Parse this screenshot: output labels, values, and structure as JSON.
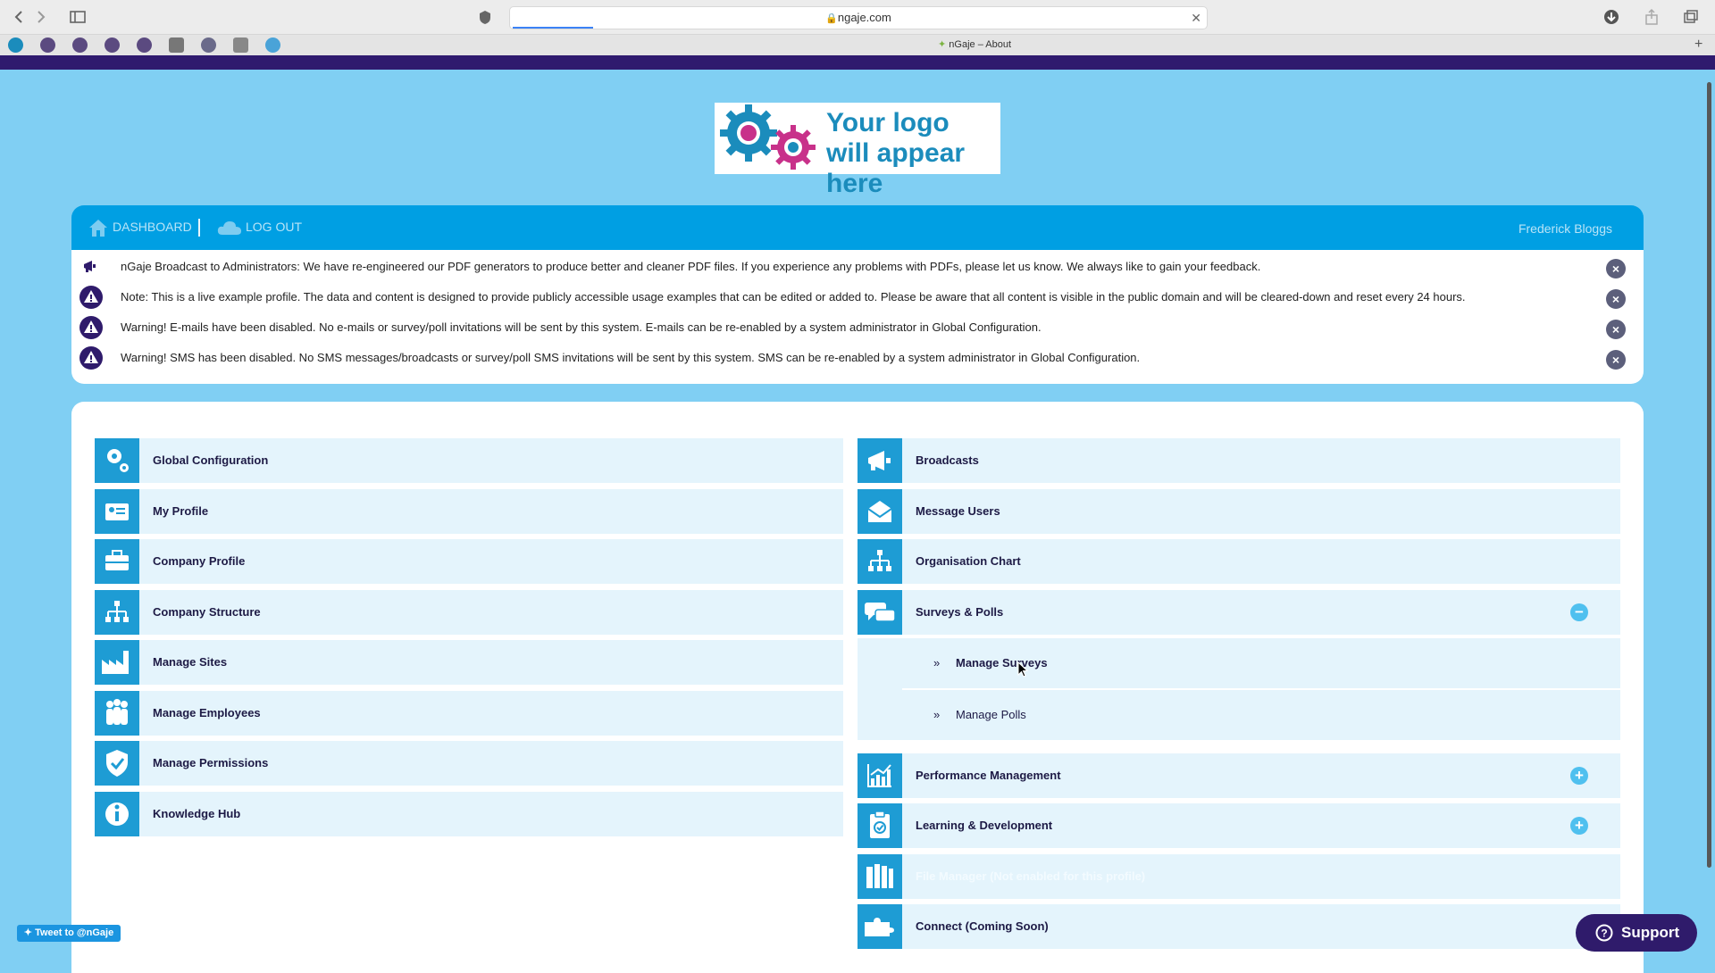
{
  "browser": {
    "url": "ngaje.com",
    "tab_title": "nGaje – About",
    "back_icon": "chevron-left-icon",
    "forward_icon": "chevron-right-icon"
  },
  "logo": {
    "text": "Your logo will appear here",
    "gear_colors": [
      "#1b8cbc",
      "#c8318a"
    ]
  },
  "nav": {
    "dashboard_label": "DASHBOARD",
    "logout_label": "LOG OUT",
    "user_name": "Frederick Bloggs"
  },
  "notices": [
    {
      "icon": "megaphone-icon",
      "text": "nGaje Broadcast to Administrators: We have re-engineered our PDF generators to produce better and cleaner PDF files. If you experience any problems with PDFs, please let us know. We always like to gain your feedback."
    },
    {
      "icon": "warning-icon",
      "text": "Note: This is a live example profile. The data and content is designed to provide publicly accessible usage examples that can be edited or added to. Please be aware that all content is visible in the public domain and will be cleared-down and reset every 24 hours."
    },
    {
      "icon": "warning-icon",
      "text": "Warning! E-mails have been disabled. No e-mails or survey/poll invitations will be sent by this system. E-mails can be re-enabled by a system administrator in Global Configuration."
    },
    {
      "icon": "warning-icon",
      "text": "Warning! SMS has been disabled. No SMS messages/broadcasts or survey/poll SMS invitations will be sent by this system. SMS can be re-enabled by a system administrator in Global Configuration."
    }
  ],
  "left_menu": [
    {
      "label": "Global Configuration",
      "icon": "gears-icon"
    },
    {
      "label": "My Profile",
      "icon": "id-card-icon"
    },
    {
      "label": "Company Profile",
      "icon": "briefcase-icon"
    },
    {
      "label": "Company Structure",
      "icon": "hierarchy-icon"
    },
    {
      "label": "Manage Sites",
      "icon": "factory-icon"
    },
    {
      "label": "Manage Employees",
      "icon": "people-icon"
    },
    {
      "label": "Manage Permissions",
      "icon": "shield-check-icon"
    },
    {
      "label": "Knowledge Hub",
      "icon": "info-icon"
    }
  ],
  "right_menu": {
    "broadcasts": "Broadcasts",
    "message_users": "Message Users",
    "organisation_chart": "Organisation Chart",
    "surveys_polls": "Surveys & Polls",
    "manage_surveys": "Manage Surveys",
    "manage_polls": "Manage Polls",
    "performance_management": "Performance Management",
    "learning_development": "Learning & Development",
    "file_manager": "File Manager (Not enabled for this profile)",
    "connect": "Connect (Coming Soon)",
    "bullet": "»",
    "collapse_symbol": "−",
    "expand_symbol": "+"
  },
  "footer": {
    "tweet_label": "Tweet to @nGaje",
    "support_label": "Support"
  },
  "colors": {
    "page_bg": "#80cff3",
    "nav_bg": "#009fe3",
    "icon_bg": "#1e9cd4",
    "item_bg": "#e4f4fc",
    "text_dark": "#1d1a45",
    "support_bg": "#2f1b6b"
  }
}
